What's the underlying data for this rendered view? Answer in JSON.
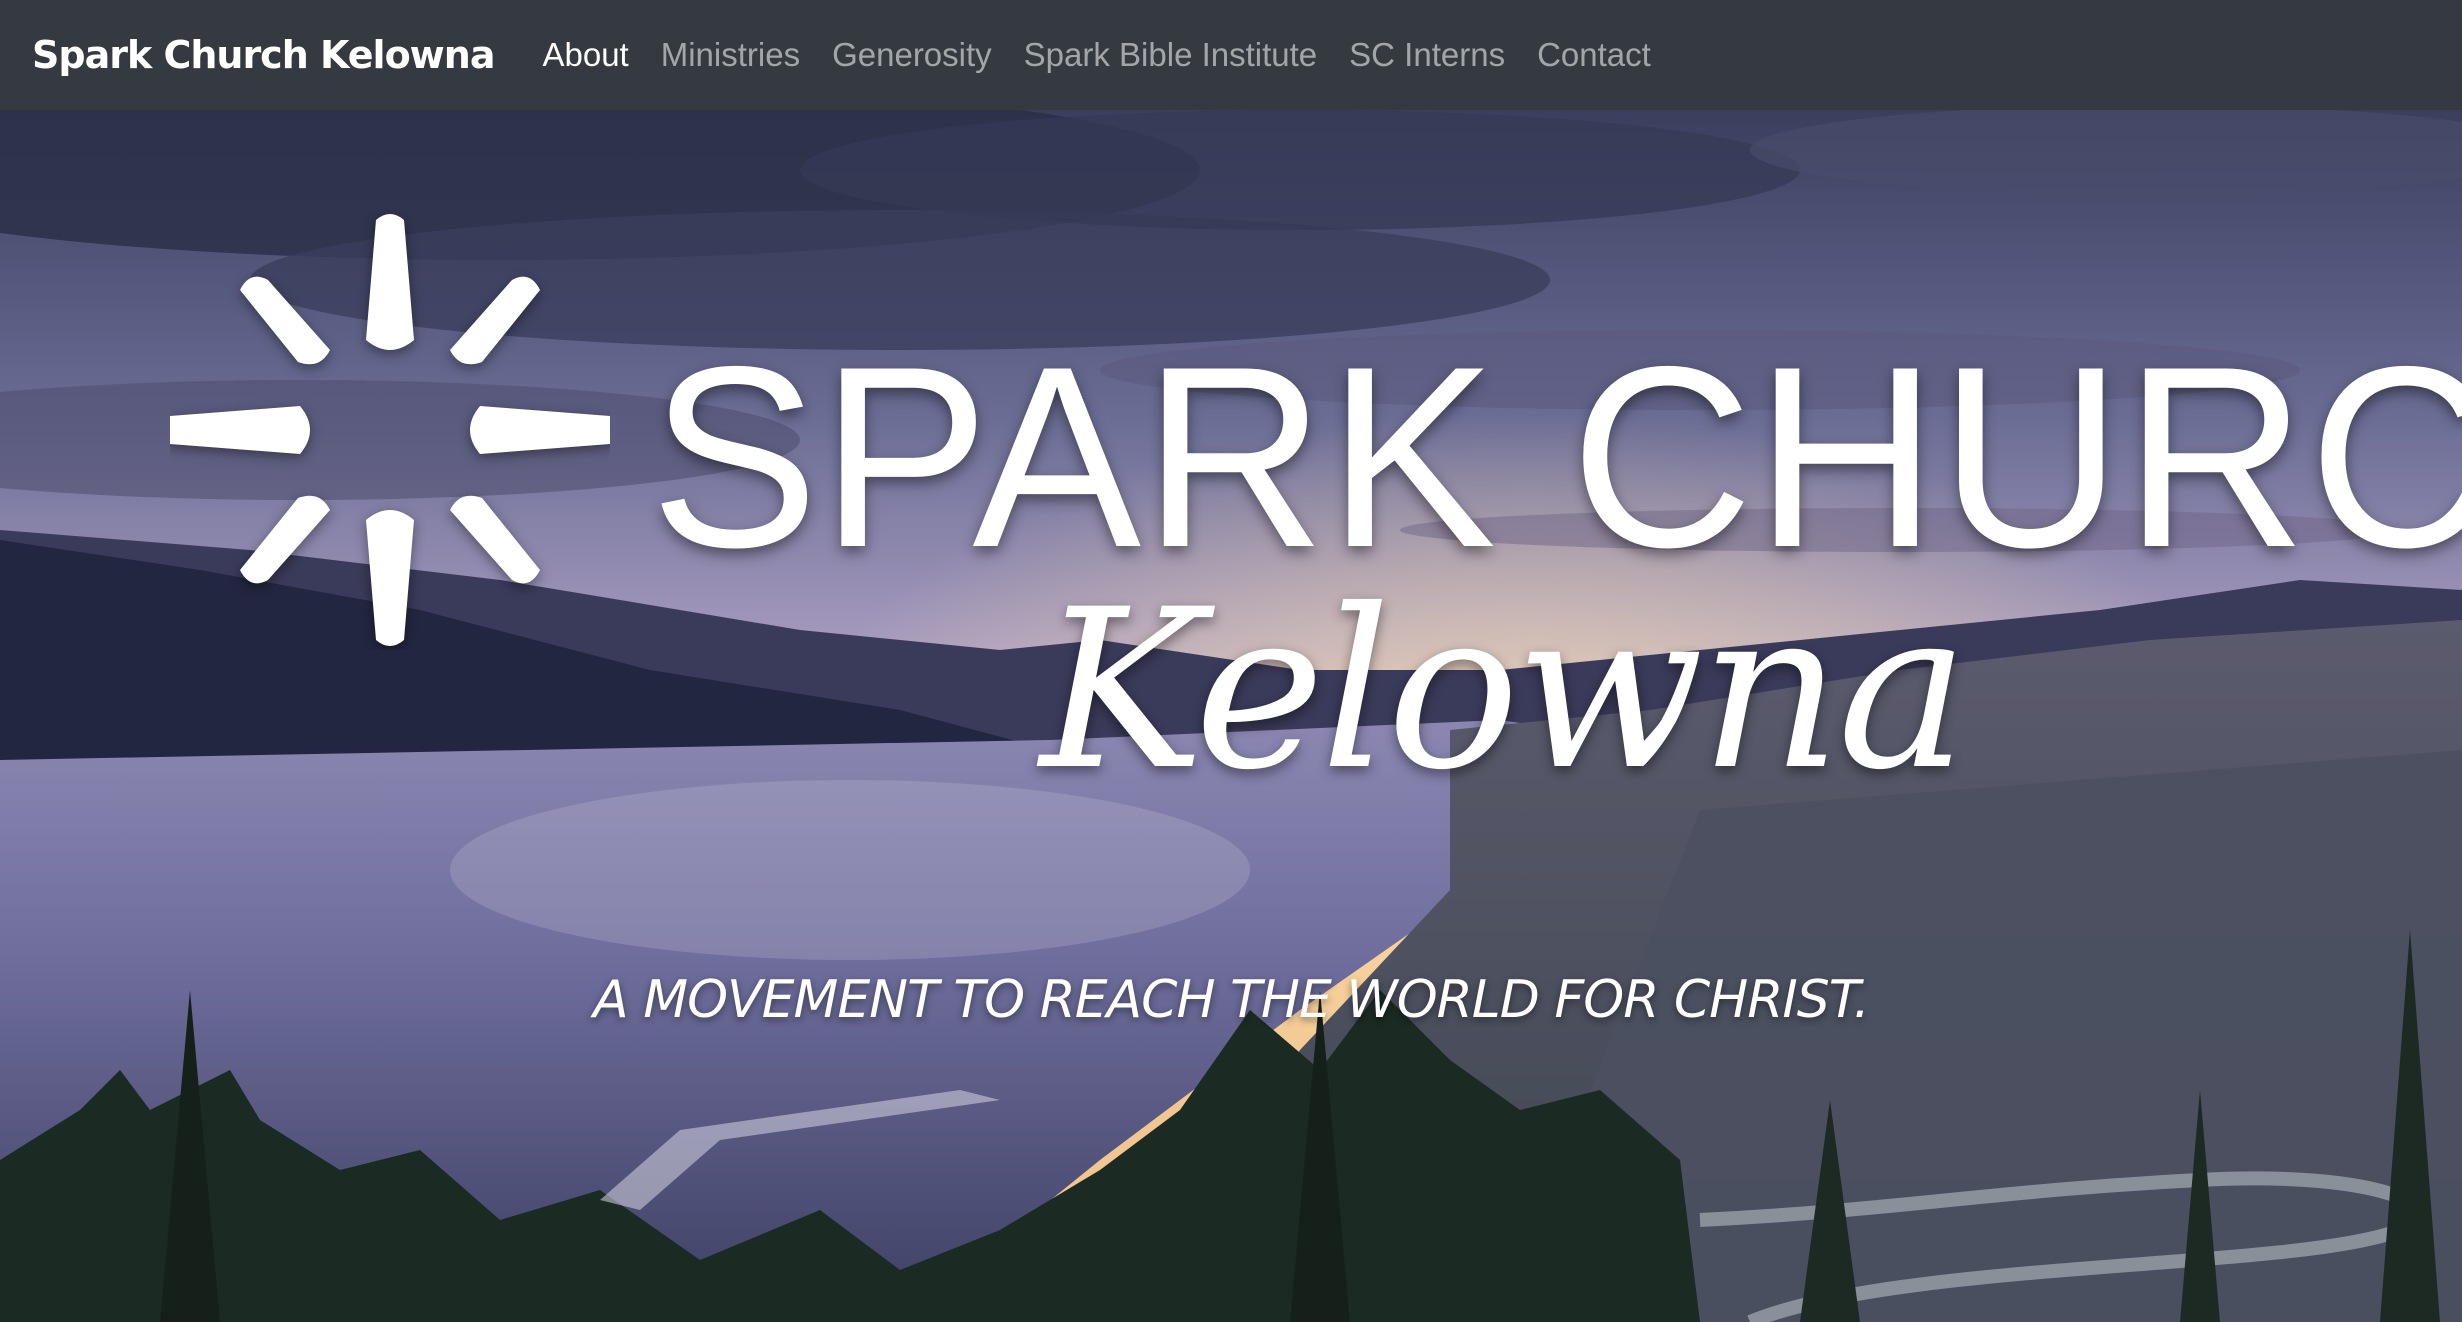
{
  "navbar": {
    "brand": "Spark Church Kelowna",
    "items": [
      {
        "label": "About",
        "active": true
      },
      {
        "label": "Ministries",
        "active": false
      },
      {
        "label": "Generosity",
        "active": false
      },
      {
        "label": "Spark Bible Institute",
        "active": false
      },
      {
        "label": "SC Interns",
        "active": false
      },
      {
        "label": "Contact",
        "active": false
      }
    ]
  },
  "hero": {
    "logo_title": "SPARK CHURCH",
    "logo_script": "Kelowna",
    "tagline": "A MOVEMENT TO REACH THE WORLD FOR CHRIST.",
    "logo_icon": "spark-icon"
  },
  "colors": {
    "navbar_bg": "#343a40",
    "nav_active": "#ffffff",
    "nav_inactive": "#9a9da0"
  }
}
